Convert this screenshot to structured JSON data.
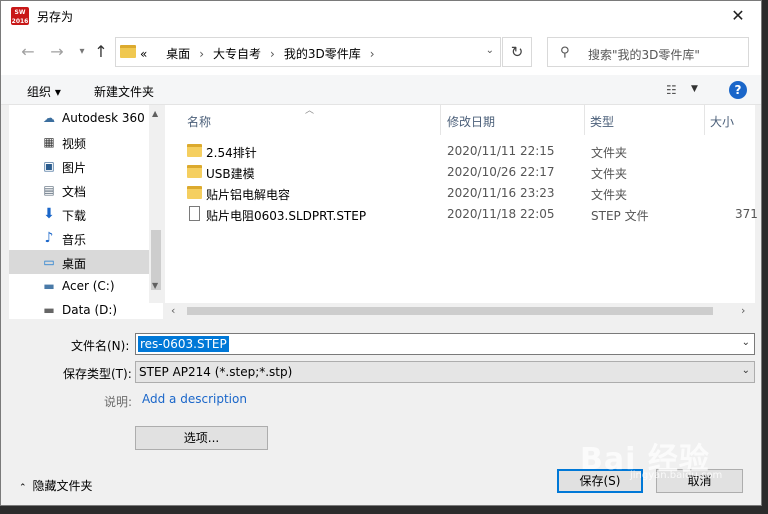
{
  "window": {
    "title": "另存为",
    "app_icon_text": "SW 2016"
  },
  "nav": {
    "breadcrumb_prefix": "«",
    "breadcrumb": [
      "桌面",
      "大专自考",
      "我的3D零件库"
    ],
    "search_placeholder": "搜索\"我的3D零件库\""
  },
  "toolbar": {
    "organize": "组织 ▾",
    "new_folder": "新建文件夹"
  },
  "sidebar": {
    "items": [
      {
        "label": "Autodesk 360",
        "icon": "cloud-icon"
      },
      {
        "label": "视频",
        "icon": "video-icon"
      },
      {
        "label": "图片",
        "icon": "pictures-icon"
      },
      {
        "label": "文档",
        "icon": "documents-icon"
      },
      {
        "label": "下载",
        "icon": "download-icon"
      },
      {
        "label": "音乐",
        "icon": "music-icon"
      },
      {
        "label": "桌面",
        "icon": "desktop-icon",
        "selected": true
      },
      {
        "label": "Acer (C:)",
        "icon": "drive-icon"
      },
      {
        "label": "Data (D:)",
        "icon": "drive-icon"
      }
    ]
  },
  "files": {
    "columns": {
      "name": "名称",
      "modified": "修改日期",
      "type": "类型",
      "size": "大小"
    },
    "rows": [
      {
        "name": "2.54排针",
        "modified": "2020/11/11 22:15",
        "type": "文件夹",
        "size": "",
        "kind": "folder"
      },
      {
        "name": "USB建模",
        "modified": "2020/10/26 22:17",
        "type": "文件夹",
        "size": "",
        "kind": "folder"
      },
      {
        "name": "贴片铝电解电容",
        "modified": "2020/11/16 23:23",
        "type": "文件夹",
        "size": "",
        "kind": "folder"
      },
      {
        "name": "贴片电阻0603.SLDPRT.STEP",
        "modified": "2020/11/18 22:05",
        "type": "STEP 文件",
        "size": "371",
        "kind": "file"
      }
    ]
  },
  "form": {
    "filename_label": "文件名(N):",
    "filename_value": "res-0603.STEP",
    "filetype_label": "保存类型(T):",
    "filetype_value": "STEP AP214 (*.step;*.stp)",
    "description_label": "说明:",
    "description_link": "Add a description",
    "options_button": "选项...",
    "hide_folders": "隐藏文件夹",
    "save_button": "保存(S)",
    "cancel_button": "取消"
  },
  "watermark": {
    "text": "Bai 经验",
    "sub": "jingyan.baidu.com"
  }
}
